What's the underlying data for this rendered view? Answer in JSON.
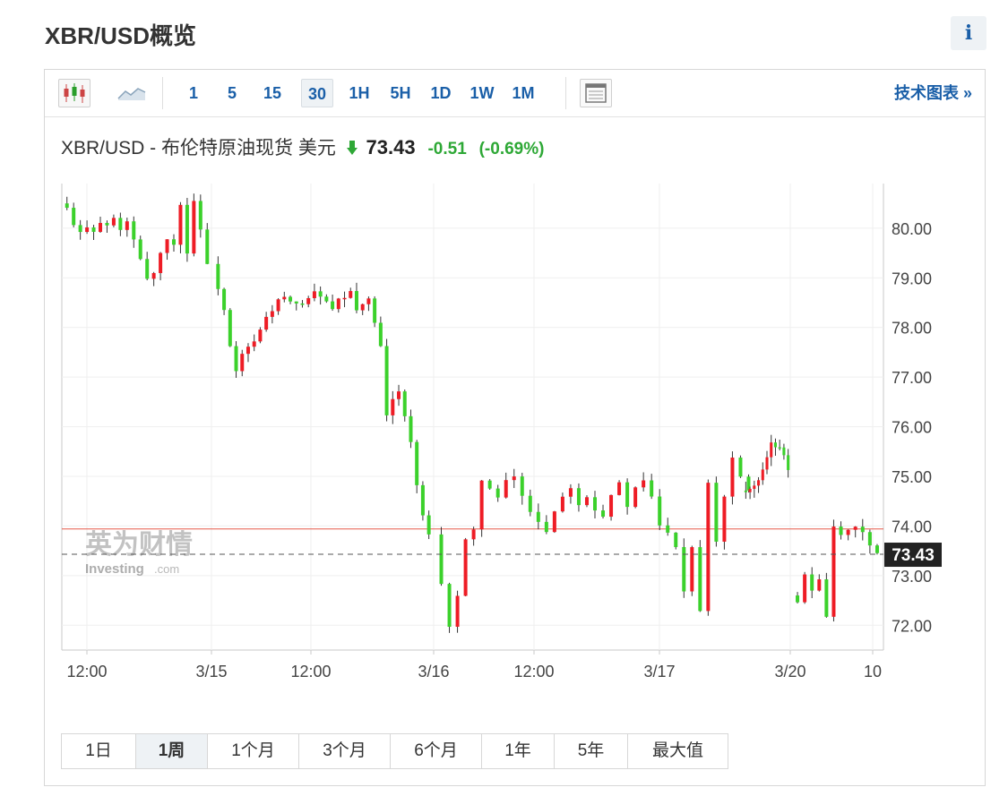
{
  "page": {
    "title": "XBR/USD概览",
    "info_label": "i"
  },
  "toolbar": {
    "intervals": [
      "1",
      "5",
      "15",
      "30",
      "1H",
      "5H",
      "1D",
      "1W",
      "1M"
    ],
    "active_interval": "30",
    "tech_chart_label": "技术图表 »"
  },
  "quote": {
    "name": "XBR/USD - 布伦特原油现货 美元",
    "price": "73.43",
    "change": "-0.51",
    "change_pct": "(-0.69%)",
    "direction": "down"
  },
  "watermark": {
    "cn": "英为财情",
    "en": "Investing",
    "domain": ".com"
  },
  "ranges": {
    "items": [
      "1日",
      "1周",
      "1个月",
      "3个月",
      "6个月",
      "1年",
      "5年",
      "最大值"
    ],
    "active": "1周"
  },
  "colors": {
    "up": "#ee1c25",
    "down": "#3bd12b",
    "accent": "#1a5fa8",
    "change": "#2ea836",
    "prev_close_line": "#e55a4a"
  },
  "chart_data": {
    "type": "candlestick",
    "title": "XBR/USD - 布伦特原油现货 美元",
    "interval": "30",
    "y_ticks": [
      "80.00",
      "79.00",
      "78.00",
      "77.00",
      "76.00",
      "75.00",
      "74.00",
      "73.00",
      "72.00"
    ],
    "ylim": [
      71.5,
      80.9
    ],
    "x_tick_labels": [
      "12:00",
      "3/15",
      "12:00",
      "3/16",
      "12:00",
      "3/17",
      "3/20",
      "10"
    ],
    "last_price": 73.43,
    "last_price_label": "73.43",
    "reference_line": 73.94,
    "grid": true,
    "price_path": [
      {
        "seg": "3/14 12:00-24:00",
        "points": [
          80.4,
          80.05,
          79.9,
          80.05,
          79.95,
          80.1,
          80.05,
          80.2,
          79.95,
          80.15,
          79.75,
          79.35,
          79.0,
          79.1,
          79.5,
          79.8,
          79.65,
          80.5,
          79.5,
          80.55,
          80.0,
          79.25
        ]
      },
      {
        "seg": "3/15",
        "points": [
          78.8,
          78.35,
          77.6,
          77.1,
          77.45,
          77.6,
          77.7,
          77.95,
          78.2,
          78.35,
          78.55,
          78.6,
          78.5,
          78.45,
          78.5,
          78.6,
          78.7,
          78.65,
          78.5,
          78.35,
          78.55,
          78.6,
          78.7,
          78.35,
          78.5,
          78.55,
          78.1,
          77.6,
          76.2,
          76.55,
          76.75,
          76.2,
          75.7,
          74.8,
          74.2,
          73.8
        ]
      },
      {
        "seg": "3/16",
        "points": [
          72.8,
          72.0,
          72.6,
          73.7,
          73.9,
          74.95,
          74.75,
          74.55,
          74.9,
          75.0,
          74.6,
          74.3,
          74.1,
          73.9,
          74.3,
          74.6,
          74.8,
          74.45,
          74.6,
          74.35,
          74.2,
          74.65,
          74.85,
          74.4,
          74.75,
          74.9,
          74.6,
          74.0,
          73.9,
          73.6,
          72.7,
          73.6,
          72.3,
          74.9,
          73.7,
          74.6,
          75.4,
          75.0,
          74.75
        ]
      },
      {
        "seg": "3/17",
        "points": [
          74.7,
          74.75,
          74.8,
          74.9,
          75.1,
          75.35,
          75.7,
          75.55,
          75.6,
          75.45,
          75.15
        ]
      },
      {
        "seg": "3/20",
        "points": [
          72.5,
          73.0,
          72.7,
          72.95,
          72.2,
          73.95,
          73.8,
          73.9,
          73.95,
          73.9,
          73.6,
          73.43
        ]
      }
    ]
  }
}
